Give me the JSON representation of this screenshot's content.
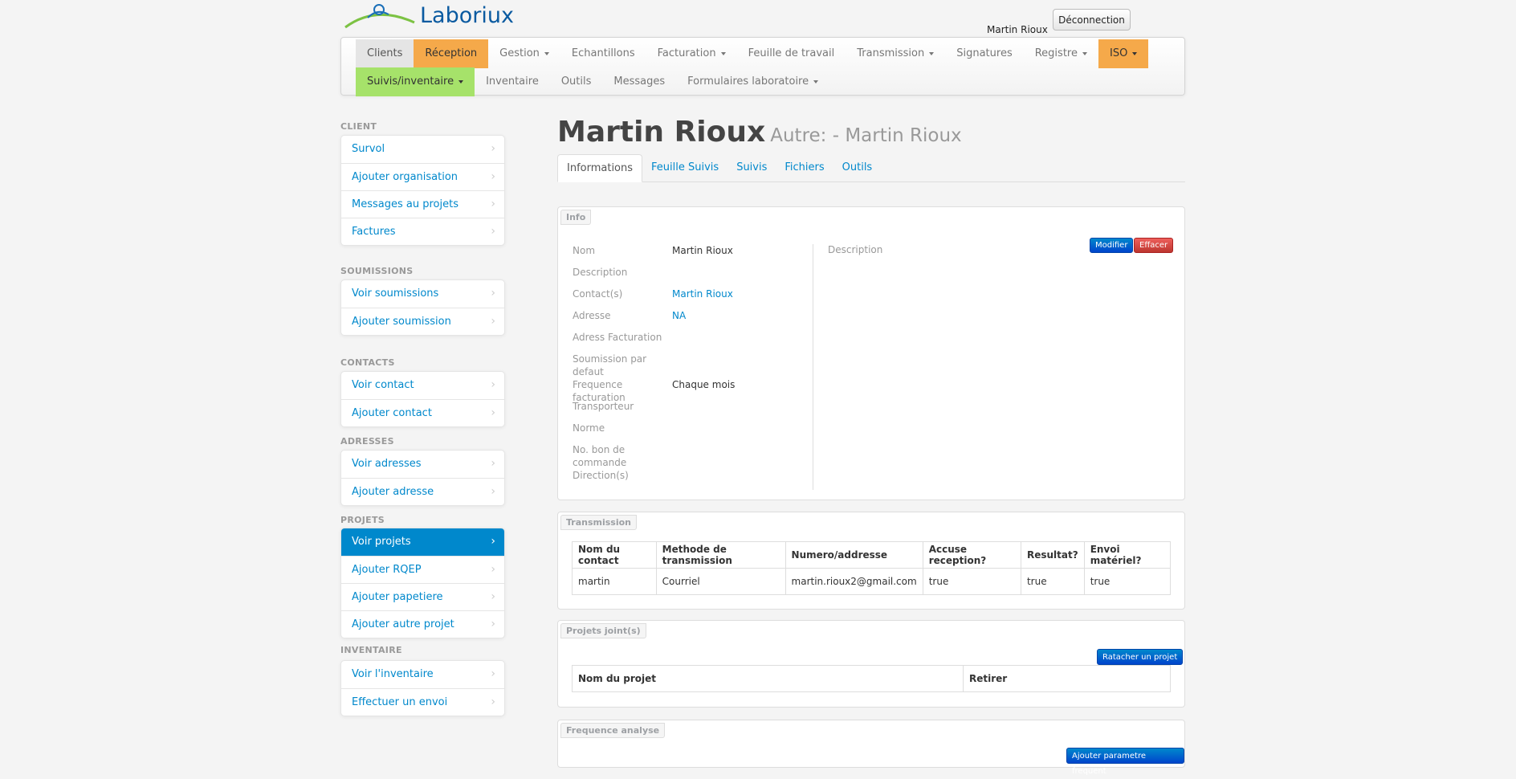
{
  "header": {
    "brand": "Laboriux",
    "user_name": "Martin Rioux",
    "logout_label": "Déconnection"
  },
  "nav": {
    "row1": [
      {
        "label": "Clients",
        "style": "active-grey",
        "caret": false
      },
      {
        "label": "Réception",
        "style": "orange",
        "caret": false
      },
      {
        "label": "Gestion",
        "style": "",
        "caret": true
      },
      {
        "label": "Echantillons",
        "style": "",
        "caret": false
      },
      {
        "label": "Facturation",
        "style": "",
        "caret": true
      },
      {
        "label": "Feuille de travail",
        "style": "",
        "caret": false
      },
      {
        "label": "Transmission",
        "style": "",
        "caret": true
      },
      {
        "label": "Signatures",
        "style": "",
        "caret": false
      },
      {
        "label": "Registre",
        "style": "",
        "caret": true
      },
      {
        "label": "ISO",
        "style": "orange",
        "caret": true
      }
    ],
    "row2": [
      {
        "label": "Suivis/inventaire",
        "style": "green",
        "caret": true
      },
      {
        "label": "Inventaire",
        "style": "",
        "caret": false
      },
      {
        "label": "Outils",
        "style": "",
        "caret": false
      },
      {
        "label": "Messages",
        "style": "",
        "caret": false
      },
      {
        "label": "Formulaires laboratoire",
        "style": "",
        "caret": true
      }
    ]
  },
  "sidebar": {
    "client": {
      "heading": "CLIENT",
      "items": [
        "Survol",
        "Ajouter organisation",
        "Messages au projets",
        "Factures"
      ]
    },
    "soumissions": {
      "heading": "SOUMISSIONS",
      "items": [
        "Voir soumissions",
        "Ajouter soumission"
      ]
    },
    "contacts": {
      "heading": "CONTACTS",
      "items": [
        "Voir contact",
        "Ajouter contact"
      ]
    },
    "adresses": {
      "heading": "ADRESSES",
      "items": [
        "Voir adresses",
        "Ajouter adresse"
      ]
    },
    "projets": {
      "heading": "PROJETS",
      "items": [
        "Voir projets",
        "Ajouter RQEP",
        "Ajouter papetiere",
        "Ajouter autre projet"
      ],
      "active_index": 0
    },
    "inventaire": {
      "heading": "INVENTAIRE",
      "items": [
        "Voir l'inventaire",
        "Effectuer un envoi"
      ]
    }
  },
  "page": {
    "title": "Martin Rioux",
    "subtitle": "Autre: - Martin Rioux",
    "tabs": [
      "Informations",
      "Feuille Suivis",
      "Suivis",
      "Fichiers",
      "Outils"
    ],
    "active_tab": 0
  },
  "info": {
    "panel_label": "Info",
    "rows": [
      {
        "label": "Nom",
        "value": "Martin Rioux",
        "link": false
      },
      {
        "label": "Description",
        "value": "",
        "link": false
      },
      {
        "label": "Contact(s)",
        "value": "Martin Rioux",
        "link": true
      },
      {
        "label": "Adresse",
        "value": "NA",
        "link": true
      },
      {
        "label": "Adress Facturation",
        "value": "",
        "link": false
      },
      {
        "label": "Soumission par defaut",
        "value": "",
        "link": false
      },
      {
        "label": "Frequence facturation",
        "value": "Chaque mois",
        "link": false
      },
      {
        "label": "Transporteur",
        "value": "",
        "link": false
      },
      {
        "label": "Norme",
        "value": "",
        "link": false
      },
      {
        "label": "No. bon de commande Direction(s)",
        "value": "",
        "link": false
      }
    ],
    "description_label": "Description",
    "edit_label": "Modifier",
    "delete_label": "Effacer"
  },
  "transmission": {
    "panel_label": "Transmission",
    "columns": [
      "Nom du contact",
      "Methode de transmission",
      "Numero/addresse",
      "Accuse reception?",
      "Resultat?",
      "Envoi matériel?"
    ],
    "rows": [
      [
        "martin",
        "Courriel",
        "martin.rioux2@gmail.com",
        "true",
        "true",
        "true"
      ]
    ]
  },
  "projets_joints": {
    "panel_label": "Projets joint(s)",
    "attach_label": "Ratacher un projet",
    "columns": [
      "Nom du projet",
      "Retirer"
    ]
  },
  "frequence": {
    "panel_label": "Frequence analyse",
    "add_label": "Ajouter parametre frequent"
  }
}
